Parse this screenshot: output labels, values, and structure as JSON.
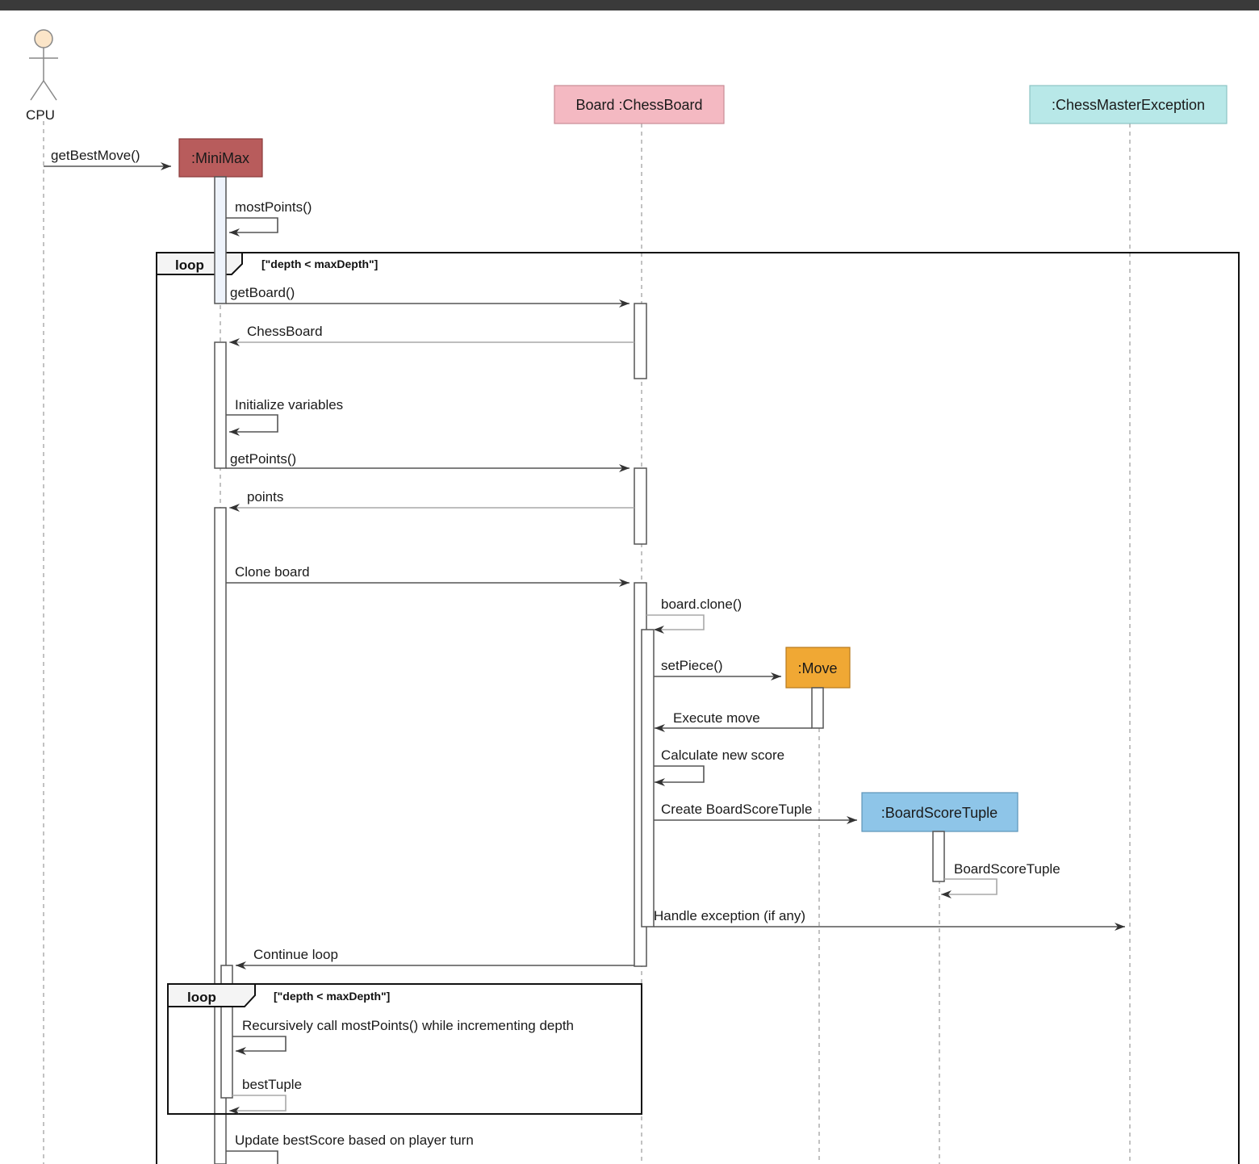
{
  "actor": {
    "label": "CPU"
  },
  "participants": {
    "minimax": {
      "label": ":MiniMax",
      "fill": "#b85c5c"
    },
    "board": {
      "label": "Board :ChessBoard",
      "fill": "#f4b9c2"
    },
    "move": {
      "label": ":Move",
      "fill": "#f0a834"
    },
    "tuple": {
      "label": ":BoardScoreTuple",
      "fill": "#8ec5e8"
    },
    "exception": {
      "label": ":ChessMasterException",
      "fill": "#b8e8e8"
    }
  },
  "frames": {
    "outer": {
      "operator": "loop",
      "guard": "[\"depth < maxDepth\"]"
    },
    "inner": {
      "operator": "loop",
      "guard": "[\"depth < maxDepth\"]"
    }
  },
  "messages": {
    "get_best_move": "getBestMove()",
    "most_points": "mostPoints()",
    "get_board": "getBoard()",
    "chess_board_return": "ChessBoard",
    "initialize_variables": "Initialize variables",
    "get_points": "getPoints()",
    "points_return": "points",
    "clone_board": "Clone board",
    "board_clone": "board.clone()",
    "set_piece": "setPiece()",
    "execute_move": "Execute move",
    "calculate_score": "Calculate new score",
    "create_tuple": "Create BoardScoreTuple",
    "tuple_self": "BoardScoreTuple",
    "handle_exception": "Handle exception (if any)",
    "continue_loop": "Continue loop",
    "recursive_call": "Recursively call mostPoints() while incrementing depth",
    "best_tuple": "bestTuple",
    "update_best_score": "Update bestScore based on player turn"
  }
}
